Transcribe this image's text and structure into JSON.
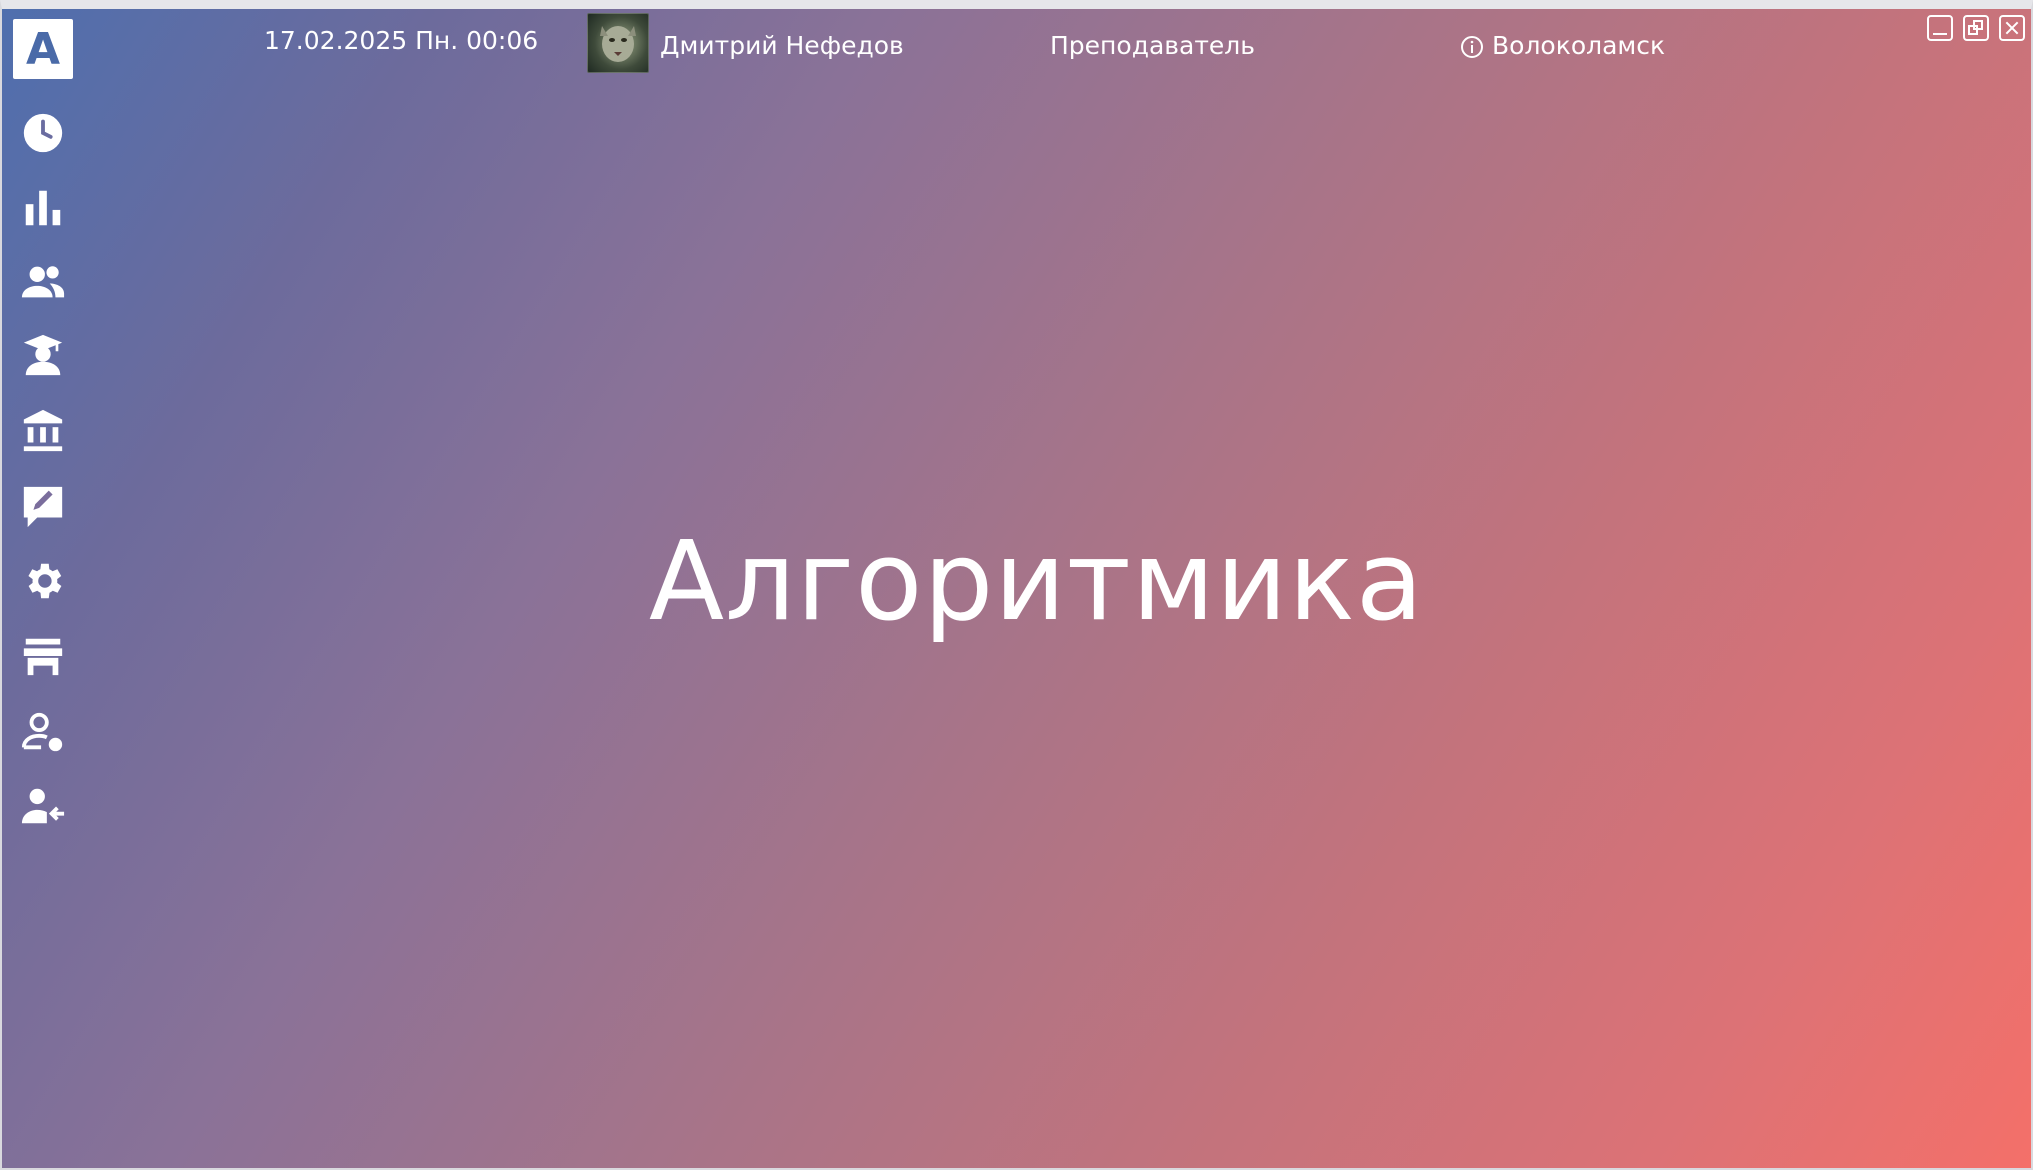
{
  "header": {
    "datetime": "17.02.2025 Пн. 00:06",
    "user_name": "Дмитрий Нефедов",
    "role": "Преподаватель",
    "location": "Волоколамск"
  },
  "sidebar": {
    "logo_letter": "A",
    "items": [
      {
        "icon": "clock-icon"
      },
      {
        "icon": "bar-chart-icon"
      },
      {
        "icon": "groups-icon"
      },
      {
        "icon": "student-icon"
      },
      {
        "icon": "institution-icon"
      },
      {
        "icon": "edit-comment-icon"
      },
      {
        "icon": "gear-icon"
      },
      {
        "icon": "store-icon"
      },
      {
        "icon": "user-status-icon"
      },
      {
        "icon": "logout-user-icon"
      }
    ]
  },
  "main": {
    "title": "Алгоритмика"
  },
  "colors": {
    "gradient_start": "#4f6fae",
    "gradient_mid": "#a97488",
    "gradient_end": "#f47069",
    "logo_text": "#4a6aa8"
  }
}
